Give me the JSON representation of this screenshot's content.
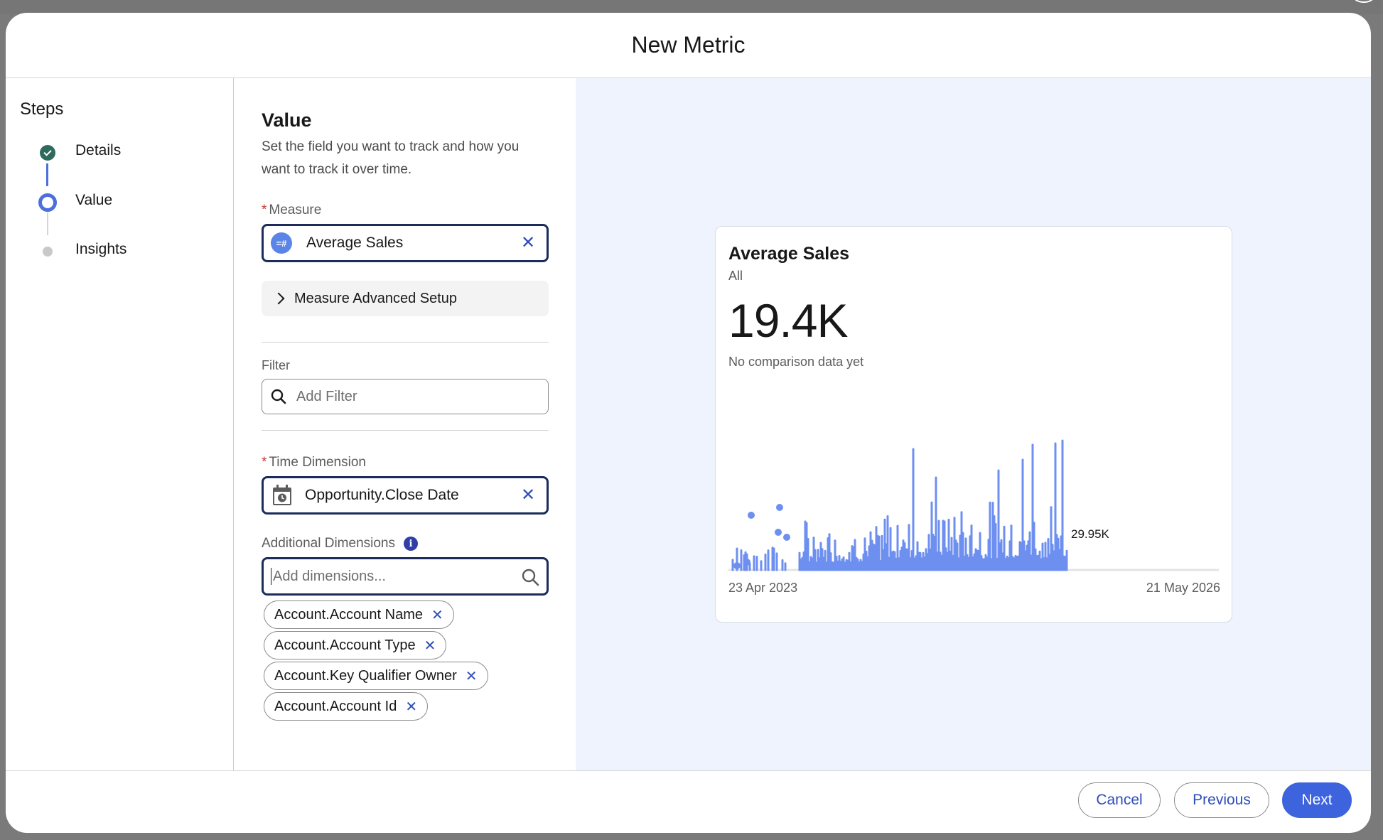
{
  "modal": {
    "title": "New Metric"
  },
  "steps": {
    "title": "Steps",
    "items": [
      {
        "label": "Details",
        "state": "complete"
      },
      {
        "label": "Value",
        "state": "current"
      },
      {
        "label": "Insights",
        "state": "upcoming"
      }
    ]
  },
  "form": {
    "title": "Value",
    "description": "Set the field you want to track and how you want to track it over time.",
    "required_mark": "*",
    "measure": {
      "label": "Measure",
      "value": "Average Sales",
      "badge": "=#"
    },
    "advanced_setup": {
      "label": "Measure Advanced Setup"
    },
    "filter": {
      "label": "Filter",
      "placeholder": "Add Filter"
    },
    "time_dimension": {
      "label": "Time Dimension",
      "value": "Opportunity.Close Date"
    },
    "additional_dimensions": {
      "label": "Additional Dimensions",
      "info": "i",
      "placeholder": "Add dimensions...",
      "chips": [
        "Account.Account Name",
        "Account.Account Type",
        "Account.Key Qualifier Owner",
        "Account.Account Id"
      ]
    }
  },
  "preview": {
    "title": "Average Sales",
    "subtitle": "All",
    "value": "19.4K",
    "note": "No comparison data yet",
    "chart_data": {
      "type": "line",
      "x_start_label": "23 Apr 2023",
      "x_end_label": "21 May 2026",
      "last_value_label": "29.95K",
      "color": "#6d8ff0"
    }
  },
  "footer": {
    "cancel": "Cancel",
    "previous": "Previous",
    "next": "Next"
  },
  "colors": {
    "brand": "#3d63dd",
    "step_complete": "#2e6b5e",
    "input_focus": "#1b2c5c",
    "preview_bg": "#eef3fd"
  }
}
